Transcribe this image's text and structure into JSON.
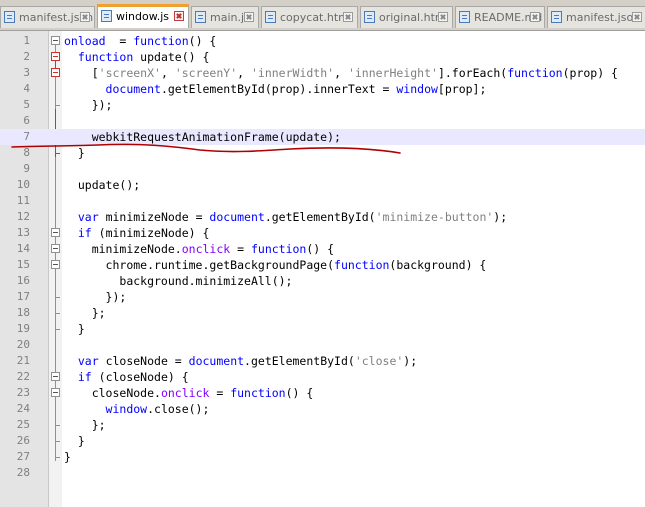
{
  "tabs": [
    {
      "label": "manifest.json",
      "active": false
    },
    {
      "label": "window.js",
      "active": true
    },
    {
      "label": "main.js",
      "active": false
    },
    {
      "label": "copycat.html",
      "active": false
    },
    {
      "label": "original.html",
      "active": false
    },
    {
      "label": "README.md",
      "active": false
    },
    {
      "label": "manifest.json",
      "active": false
    }
  ],
  "editor": {
    "highlighted_line": 7,
    "lines": [
      {
        "n": "1",
        "indent": "",
        "t": [
          [
            "k",
            "onload"
          ],
          [
            "",
            "  = "
          ],
          [
            "k",
            "function"
          ],
          [
            "",
            "() {"
          ]
        ]
      },
      {
        "n": "2",
        "indent": "  ",
        "t": [
          [
            "k",
            "function"
          ],
          [
            "",
            " update() {"
          ]
        ]
      },
      {
        "n": "3",
        "indent": "    ",
        "t": [
          [
            "",
            "["
          ],
          [
            "s",
            "'screenX'"
          ],
          [
            "",
            ", "
          ],
          [
            "s",
            "'screenY'"
          ],
          [
            "",
            ", "
          ],
          [
            "s",
            "'innerWidth'"
          ],
          [
            "",
            ", "
          ],
          [
            "s",
            "'innerHeight'"
          ],
          [
            "",
            "].forEach("
          ],
          [
            "k",
            "function"
          ],
          [
            "",
            "(prop) {"
          ]
        ]
      },
      {
        "n": "4",
        "indent": "      ",
        "t": [
          [
            "k",
            "document"
          ],
          [
            "",
            "."
          ],
          [
            "",
            "getElementById"
          ],
          [
            "",
            "(prop)."
          ],
          [
            "",
            "innerText"
          ],
          [
            "",
            " = "
          ],
          [
            "k",
            "window"
          ],
          [
            "",
            "[prop];"
          ]
        ]
      },
      {
        "n": "5",
        "indent": "    ",
        "t": [
          [
            "",
            "});"
          ]
        ]
      },
      {
        "n": "6",
        "indent": "",
        "t": []
      },
      {
        "n": "7",
        "indent": "    ",
        "t": [
          [
            "",
            "webkitRequestAnimationFrame(update);"
          ]
        ]
      },
      {
        "n": "8",
        "indent": "  ",
        "t": [
          [
            "",
            "}"
          ]
        ]
      },
      {
        "n": "9",
        "indent": "",
        "t": []
      },
      {
        "n": "10",
        "indent": "  ",
        "t": [
          [
            "",
            "update();"
          ]
        ]
      },
      {
        "n": "11",
        "indent": "",
        "t": []
      },
      {
        "n": "12",
        "indent": "  ",
        "t": [
          [
            "k",
            "var"
          ],
          [
            "",
            " minimizeNode = "
          ],
          [
            "k",
            "document"
          ],
          [
            "",
            ".getElementById("
          ],
          [
            "s",
            "'minimize-button'"
          ],
          [
            "",
            ");"
          ]
        ]
      },
      {
        "n": "13",
        "indent": "  ",
        "t": [
          [
            "k",
            "if"
          ],
          [
            "",
            " (minimizeNode) {"
          ]
        ]
      },
      {
        "n": "14",
        "indent": "    ",
        "t": [
          [
            "",
            "minimizeNode."
          ],
          [
            "g",
            "onclick"
          ],
          [
            "",
            " = "
          ],
          [
            "k",
            "function"
          ],
          [
            "",
            "() {"
          ]
        ]
      },
      {
        "n": "15",
        "indent": "      ",
        "t": [
          [
            "",
            "chrome.runtime.getBackgroundPage("
          ],
          [
            "k",
            "function"
          ],
          [
            "",
            "(background) {"
          ]
        ]
      },
      {
        "n": "16",
        "indent": "        ",
        "t": [
          [
            "",
            "background.minimizeAll();"
          ]
        ]
      },
      {
        "n": "17",
        "indent": "      ",
        "t": [
          [
            "",
            "});"
          ]
        ]
      },
      {
        "n": "18",
        "indent": "    ",
        "t": [
          [
            "",
            "};"
          ]
        ]
      },
      {
        "n": "19",
        "indent": "  ",
        "t": [
          [
            "",
            "}"
          ]
        ]
      },
      {
        "n": "20",
        "indent": "",
        "t": []
      },
      {
        "n": "21",
        "indent": "  ",
        "t": [
          [
            "k",
            "var"
          ],
          [
            "",
            " closeNode = "
          ],
          [
            "k",
            "document"
          ],
          [
            "",
            ".getElementById("
          ],
          [
            "s",
            "'close'"
          ],
          [
            "",
            ");"
          ]
        ]
      },
      {
        "n": "22",
        "indent": "  ",
        "t": [
          [
            "k",
            "if"
          ],
          [
            "",
            " (closeNode) {"
          ]
        ]
      },
      {
        "n": "23",
        "indent": "    ",
        "t": [
          [
            "",
            "closeNode."
          ],
          [
            "g",
            "onclick"
          ],
          [
            "",
            " = "
          ],
          [
            "k",
            "function"
          ],
          [
            "",
            "() {"
          ]
        ]
      },
      {
        "n": "24",
        "indent": "      ",
        "t": [
          [
            "k",
            "window"
          ],
          [
            "",
            ".close();"
          ]
        ]
      },
      {
        "n": "25",
        "indent": "    ",
        "t": [
          [
            "",
            "};"
          ]
        ]
      },
      {
        "n": "26",
        "indent": "  ",
        "t": [
          [
            "",
            "}"
          ]
        ]
      },
      {
        "n": "27",
        "indent": "",
        "t": [
          [
            "",
            "}"
          ]
        ]
      },
      {
        "n": "28",
        "indent": "",
        "t": []
      }
    ]
  },
  "colors": {
    "keyword": "#0000ff",
    "string": "#808080",
    "property": "#8000ff",
    "active_tab_accent": "#f0a030",
    "current_line": "#e8e8ff",
    "annotation_ink": "#b00000"
  },
  "icons": {
    "tab_file": "file-icon",
    "tab_close": "close-icon",
    "fold_open": "fold-minus-icon"
  }
}
